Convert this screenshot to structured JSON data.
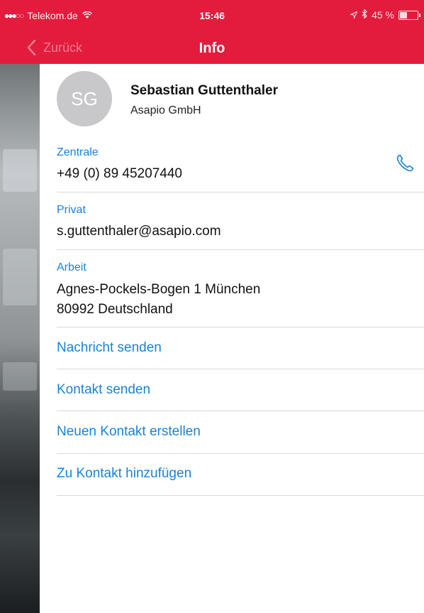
{
  "status_bar": {
    "carrier": "Telekom.de",
    "time": "15:46",
    "battery": "45 %",
    "battery_level": 0.45
  },
  "nav": {
    "back_label": "Zurück",
    "title": "Info"
  },
  "contact": {
    "initials": "SG",
    "name": "Sebastian Guttenthaler",
    "company": "Asapio GmbH"
  },
  "fields": {
    "central_label": "Zentrale",
    "central_value": "+49 (0) 89 45207440",
    "private_label": "Privat",
    "private_value": "s.guttenthaler@asapio.com",
    "work_label": "Arbeit",
    "work_line1": "Agnes-Pockels-Bogen 1 München",
    "work_line2": "80992 Deutschland"
  },
  "actions": {
    "send_message": "Nachricht senden",
    "send_contact": "Kontakt senden",
    "new_contact": "Neuen Kontakt erstellen",
    "add_to_contact": "Zu Kontakt hinzufügen"
  },
  "colors": {
    "accent_red": "#e31c3d",
    "link_blue": "#1a82d6"
  },
  "icons": {
    "back": "chevron-left-icon",
    "phone": "phone-icon",
    "wifi": "wifi-icon",
    "bluetooth": "bluetooth-icon",
    "location": "location-arrow-icon",
    "battery": "battery-icon"
  }
}
